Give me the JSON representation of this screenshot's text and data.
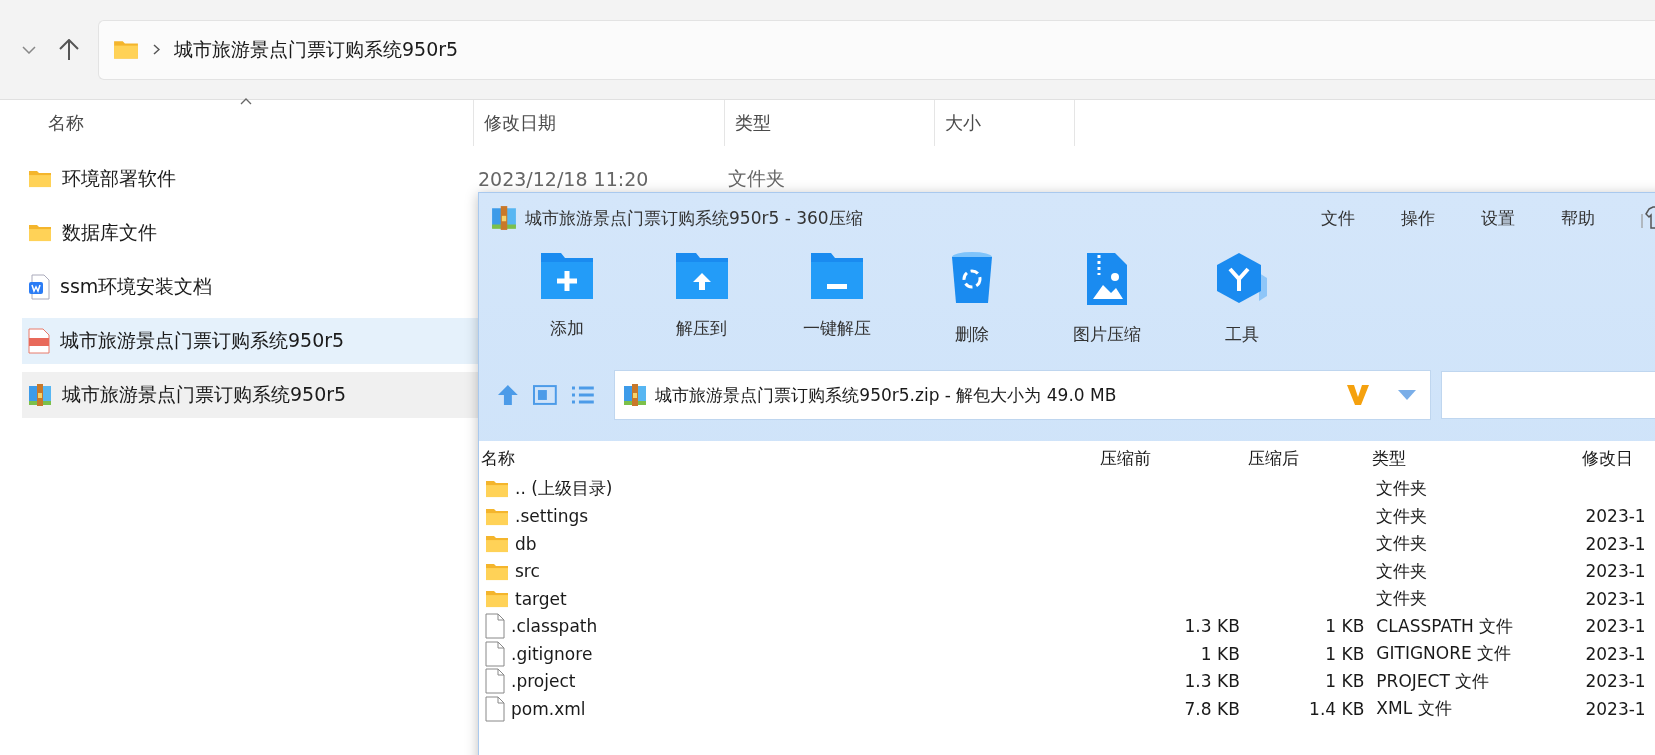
{
  "explorer": {
    "path": "城市旅游景点门票订购系统950r5",
    "columns": [
      {
        "label": "名称",
        "sorted": true
      },
      {
        "label": "修改日期",
        "sorted": false
      },
      {
        "label": "类型",
        "sorted": false
      },
      {
        "label": "大小",
        "sorted": false
      }
    ],
    "rows": [
      {
        "name": "环境部署软件",
        "kind": "folder",
        "date": "2023/12/18 11:20",
        "type": "文件夹",
        "selected": false,
        "hovered": false
      },
      {
        "name": "数据库文件",
        "kind": "folder",
        "selected": false,
        "hovered": false
      },
      {
        "name": "ssm环境安装文档",
        "kind": "doc",
        "selected": false,
        "hovered": false
      },
      {
        "name": "城市旅游景点门票订购系统950r5",
        "kind": "video",
        "selected": true,
        "hovered": false
      },
      {
        "name": "城市旅游景点门票订购系统950r5",
        "kind": "archive",
        "selected": false,
        "hovered": true
      }
    ]
  },
  "archiver": {
    "title": "城市旅游景点门票订购系统950r5 - 360压缩",
    "menu": [
      "文件",
      "操作",
      "设置",
      "帮助"
    ],
    "tools": [
      {
        "label": "添加",
        "kind": "add"
      },
      {
        "label": "解压到",
        "kind": "extract"
      },
      {
        "label": "一键解压",
        "kind": "quick"
      },
      {
        "label": "删除",
        "kind": "delete"
      },
      {
        "label": "图片压缩",
        "kind": "image"
      },
      {
        "label": "工具",
        "kind": "tools"
      }
    ],
    "path": "城市旅游景点门票订购系统950r5.zip - 解包大小为 49.0 MB",
    "columns": [
      "名称",
      "压缩前",
      "压缩后",
      "类型",
      "修改日"
    ],
    "rows": [
      {
        "name": ".. (上级目录)",
        "kind": "folder",
        "type": "文件夹"
      },
      {
        "name": ".settings",
        "kind": "folder",
        "type": "文件夹",
        "date": "2023-1"
      },
      {
        "name": "db",
        "kind": "folder",
        "type": "文件夹",
        "date": "2023-1"
      },
      {
        "name": "src",
        "kind": "folder",
        "type": "文件夹",
        "date": "2023-1"
      },
      {
        "name": "target",
        "kind": "folder",
        "type": "文件夹",
        "date": "2023-1"
      },
      {
        "name": ".classpath",
        "kind": "file",
        "before": "1.3 KB",
        "after": "1 KB",
        "type": "CLASSPATH 文件",
        "date": "2023-1"
      },
      {
        "name": ".gitignore",
        "kind": "file",
        "before": "1 KB",
        "after": "1 KB",
        "type": "GITIGNORE 文件",
        "date": "2023-1"
      },
      {
        "name": ".project",
        "kind": "file",
        "before": "1.3 KB",
        "after": "1 KB",
        "type": "PROJECT 文件",
        "date": "2023-1"
      },
      {
        "name": "pom.xml",
        "kind": "file",
        "before": "7.8 KB",
        "after": "1.4 KB",
        "type": "XML 文件",
        "date": "2023-1"
      }
    ]
  }
}
